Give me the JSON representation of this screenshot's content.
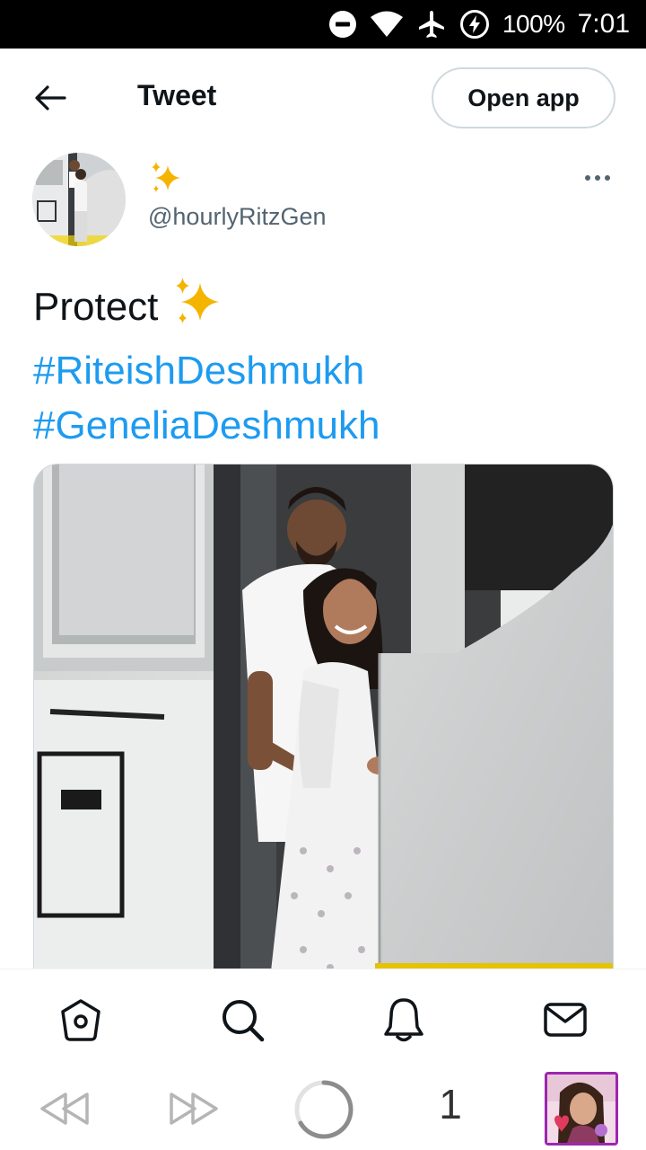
{
  "status_bar": {
    "battery": "100%",
    "time": "7:01",
    "icons": [
      "do-not-disturb-icon",
      "wifi-icon",
      "airplane-icon",
      "battery-saver-icon"
    ]
  },
  "header": {
    "title": "Tweet",
    "open_app_label": "Open app",
    "back_icon": "back-arrow-icon"
  },
  "tweet": {
    "display_name": "✨",
    "handle": "@hourlyRitzGen",
    "text_lines": {
      "first": "Protect",
      "hashtag1": "#RiteishDeshmukh",
      "hashtag2": "#GeneliaDeshmukh"
    },
    "media_description_icon": "photo"
  },
  "bottom_nav": {
    "items": [
      "home-icon",
      "search-icon",
      "notifications-icon",
      "messages-icon"
    ]
  },
  "media_controls": {
    "count": "1",
    "icons": [
      "rewind-icon",
      "fast-forward-icon",
      "loading-spinner-icon"
    ]
  },
  "colors": {
    "link": "#1d9bf0",
    "text": "#0f1419",
    "secondary": "#536471",
    "sparkle": "#f4b400",
    "thumb_border": "#9c27b0"
  }
}
